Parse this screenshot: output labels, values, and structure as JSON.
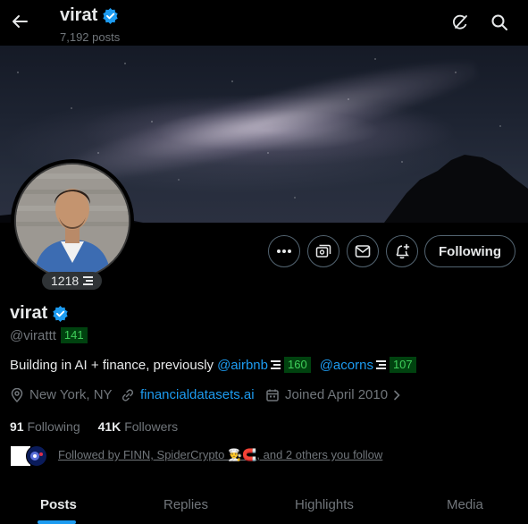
{
  "header": {
    "name": "virat",
    "post_count": "7,192 posts"
  },
  "profile": {
    "name": "virat",
    "handle": "@virattt",
    "handle_score": "141",
    "avatar_badge_value": "1218",
    "bio_prefix": "Building in AI + finance, previously",
    "bio_mention_1": "@airbnb",
    "bio_score_1": "160",
    "bio_mention_2": "@acorns",
    "bio_score_2": "107",
    "location": "New York, NY",
    "website": "financialdatasets.ai",
    "joined": "Joined April 2010",
    "following_count": "91",
    "following_label": "Following",
    "followers_count": "41K",
    "followers_label": "Followers",
    "followed_by": "Followed by FINN, SpiderCrypto 👨‍🍳🧲, and 2 others you follow"
  },
  "actions": {
    "follow_label": "Following"
  },
  "tabs": [
    {
      "label": "Posts",
      "active": true
    },
    {
      "label": "Replies",
      "active": false
    },
    {
      "label": "Highlights",
      "active": false
    },
    {
      "label": "Media",
      "active": false
    }
  ],
  "colors": {
    "background": "#000000",
    "accent": "#1d9bf0",
    "score_bg": "#00420f",
    "score_text": "#3fcf5a",
    "muted_text": "#71767b"
  }
}
